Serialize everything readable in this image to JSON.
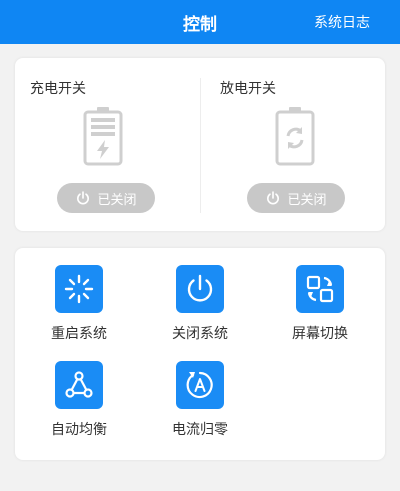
{
  "header": {
    "title": "控制",
    "log_link": "系统日志"
  },
  "charge": {
    "label": "充电开关",
    "status": "已关闭"
  },
  "discharge": {
    "label": "放电开关",
    "status": "已关闭"
  },
  "functions": [
    {
      "label": "重启系统",
      "icon": "restart-icon"
    },
    {
      "label": "关闭系统",
      "icon": "power-icon"
    },
    {
      "label": "屏幕切换",
      "icon": "screen-switch-icon"
    },
    {
      "label": "自动均衡",
      "icon": "auto-balance-icon"
    },
    {
      "label": "电流归零",
      "icon": "current-zero-icon"
    }
  ],
  "colors": {
    "primary": "#0f86f3",
    "icon_bg": "#1a8cf5",
    "toggle_off": "#c8c8c8",
    "battery_grey": "#cfcfcf"
  }
}
